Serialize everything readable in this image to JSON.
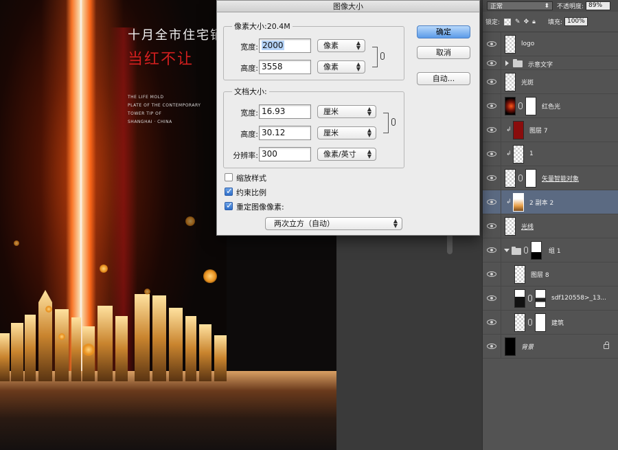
{
  "canvas": {
    "title_line1": "十月全市住宅销",
    "title_line2": "当红不让",
    "english_lines": [
      "THE LIFE MOLD",
      "PLATE OF THE CONTEMPORARY",
      "TOWER TIP OF",
      "SHANGHAI · CHINA"
    ]
  },
  "dialog": {
    "title": "图像大小",
    "pixel_dimensions": {
      "label": "像素大小:20.4M",
      "width_label": "宽度:",
      "width_value": "2000",
      "width_unit": "像素",
      "height_label": "高度:",
      "height_value": "3558",
      "height_unit": "像素"
    },
    "document_size": {
      "label": "文档大小:",
      "width_label": "宽度:",
      "width_value": "16.93",
      "width_unit": "厘米",
      "height_label": "高度:",
      "height_value": "30.12",
      "height_unit": "厘米",
      "resolution_label": "分辨率:",
      "resolution_value": "300",
      "resolution_unit": "像素/英寸"
    },
    "options": {
      "scale_styles": "缩放样式",
      "scale_styles_checked": false,
      "constrain": "约束比例",
      "constrain_checked": true,
      "resample": "重定图像像素:",
      "resample_checked": true,
      "resample_method": "两次立方（自动）"
    },
    "buttons": {
      "ok": "确定",
      "cancel": "取消",
      "auto": "自动..."
    }
  },
  "layers_panel": {
    "blend_mode": "正常",
    "opacity_label": "不透明度:",
    "opacity_value": "89%",
    "lock_label": "锁定:",
    "fill_label": "填充:",
    "fill_value": "100%",
    "layers": [
      {
        "name": "logo"
      },
      {
        "name": "示意文字"
      },
      {
        "name": "光斑"
      },
      {
        "name": "红色光"
      },
      {
        "name": "图层 7"
      },
      {
        "name": "1"
      },
      {
        "name": "矢量智能对象"
      },
      {
        "name": "2 副本 2"
      },
      {
        "name": "光线"
      },
      {
        "name": "组 1"
      },
      {
        "name": "图层 8"
      },
      {
        "name": "sdf120558>_13..."
      },
      {
        "name": "建筑"
      },
      {
        "name": "背景"
      }
    ]
  }
}
